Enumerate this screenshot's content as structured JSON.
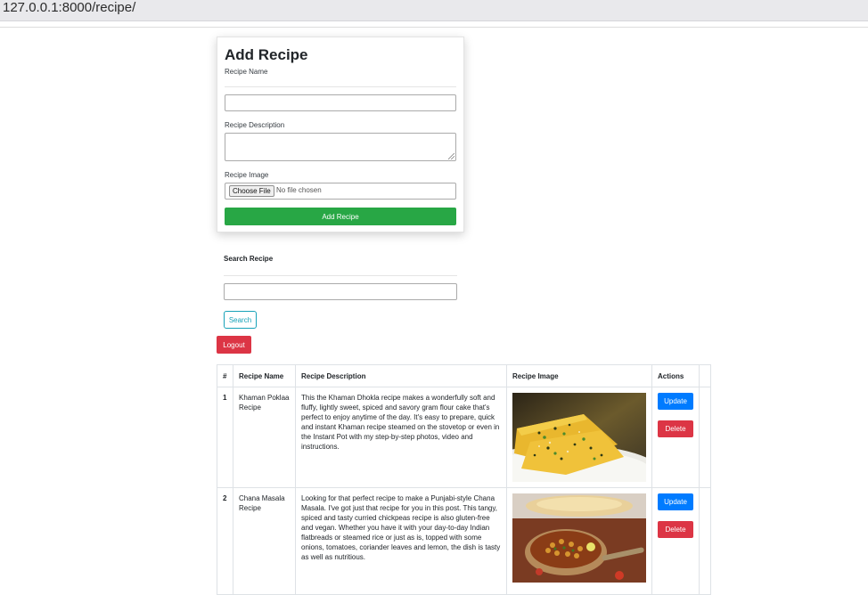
{
  "browser": {
    "url": "127.0.0.1:8000/recipe/"
  },
  "form": {
    "title": "Add Recipe",
    "name_label": "Recipe Name",
    "name_value": "",
    "desc_label": "Recipe Description",
    "desc_value": "",
    "image_label": "Recipe Image",
    "choose_file": "Choose File",
    "no_file": "No file chosen",
    "submit": "Add Recipe"
  },
  "search": {
    "title": "Search Recipe",
    "value": "",
    "button": "Search"
  },
  "logout": "Logout",
  "table": {
    "headers": [
      "#",
      "Recipe Name",
      "Recipe Description",
      "Recipe Image",
      "Actions",
      ""
    ],
    "update_label": "Update",
    "delete_label": "Delete",
    "rows": [
      {
        "num": "1",
        "name": "Khaman Poklaa Recipe",
        "description": "This the Khaman Dhokla recipe makes a wonderfully soft and fluffy, lightly sweet, spiced and savory gram flour cake that's perfect to enjoy anytime of the day. It's easy to prepare, quick and instant Khaman recipe steamed on the stovetop or even in the Instant Pot with my step-by-step photos, video and instructions.",
        "image": "khaman-dhokla-photo"
      },
      {
        "num": "2",
        "name": "Chana Masala Recipe",
        "description": "Looking for that perfect recipe to make a Punjabi-style Chana Masala. I've got just that recipe for you in this post. This tangy, spiced and tasty curried chickpeas recipe is also gluten-free and vegan. Whether you have it with your day-to-day Indian flatbreads or steamed rice or just as is, topped with some onions, tomatoes, coriander leaves and lemon, the dish is tasty as well as nutritious.",
        "image": "chana-masala-photo"
      }
    ]
  },
  "colors": {
    "success": "#28a745",
    "danger": "#dc3545",
    "primary": "#007bff",
    "info": "#17a2b8"
  }
}
